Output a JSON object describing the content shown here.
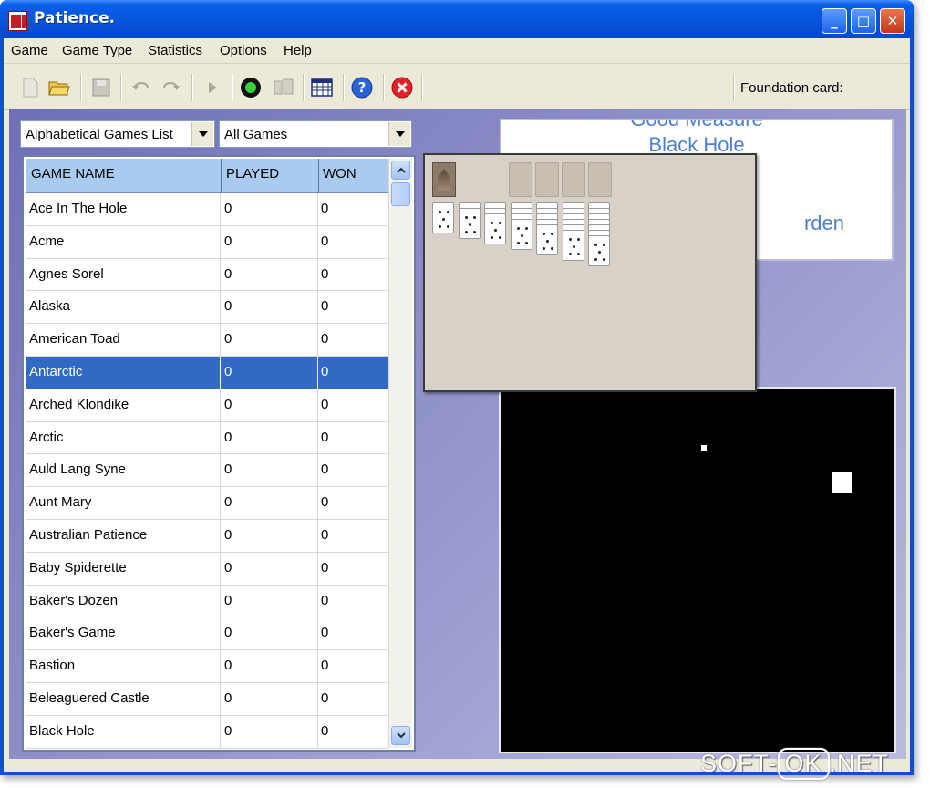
{
  "window": {
    "title": "Patience.",
    "minimize": "_",
    "maximize": "□",
    "close": "✕"
  },
  "menu": [
    "Game",
    "Game Type",
    "Statistics",
    "Options",
    "Help"
  ],
  "toolbar": {
    "icons": [
      "new-icon",
      "open-folder-icon",
      "save-icon",
      "undo-icon",
      "redo-icon",
      "play-icon",
      "record-icon",
      "deal-icon",
      "calendar-icon",
      "help-icon",
      "stop-icon"
    ],
    "foundation_label": "Foundation card:"
  },
  "filters": {
    "list_type": "Alphabetical Games List",
    "game_filter": "All Games"
  },
  "table": {
    "headers": [
      "GAME NAME",
      "PLAYED",
      "WON"
    ],
    "selected_index": 5,
    "rows": [
      [
        "Ace In The Hole",
        "0",
        "0"
      ],
      [
        "Acme",
        "0",
        "0"
      ],
      [
        "Agnes Sorel",
        "0",
        "0"
      ],
      [
        "Alaska",
        "0",
        "0"
      ],
      [
        "American Toad",
        "0",
        "0"
      ],
      [
        "Antarctic",
        "0",
        "0"
      ],
      [
        "Arched Klondike",
        "0",
        "0"
      ],
      [
        "Arctic",
        "0",
        "0"
      ],
      [
        "Auld Lang Syne",
        "0",
        "0"
      ],
      [
        "Aunt Mary",
        "0",
        "0"
      ],
      [
        "Australian Patience",
        "0",
        "0"
      ],
      [
        "Baby Spiderette",
        "0",
        "0"
      ],
      [
        "Baker's Dozen",
        "0",
        "0"
      ],
      [
        "Baker's Game",
        "0",
        "0"
      ],
      [
        "Bastion",
        "0",
        "0"
      ],
      [
        "Beleaguered Castle",
        "0",
        "0"
      ],
      [
        "Black Hole",
        "0",
        "0"
      ]
    ]
  },
  "game_names_panel": {
    "line1": "Good Measure",
    "line2": "Black Hole",
    "line3": "rden"
  },
  "watermark": {
    "left": "SOFT-",
    "ok": "OK",
    "right": ".NET"
  },
  "colors": {
    "title_blue": "#0553db",
    "selection": "#316ac5",
    "header": "#a9cbf0",
    "panel_text": "#4f7fd1"
  }
}
